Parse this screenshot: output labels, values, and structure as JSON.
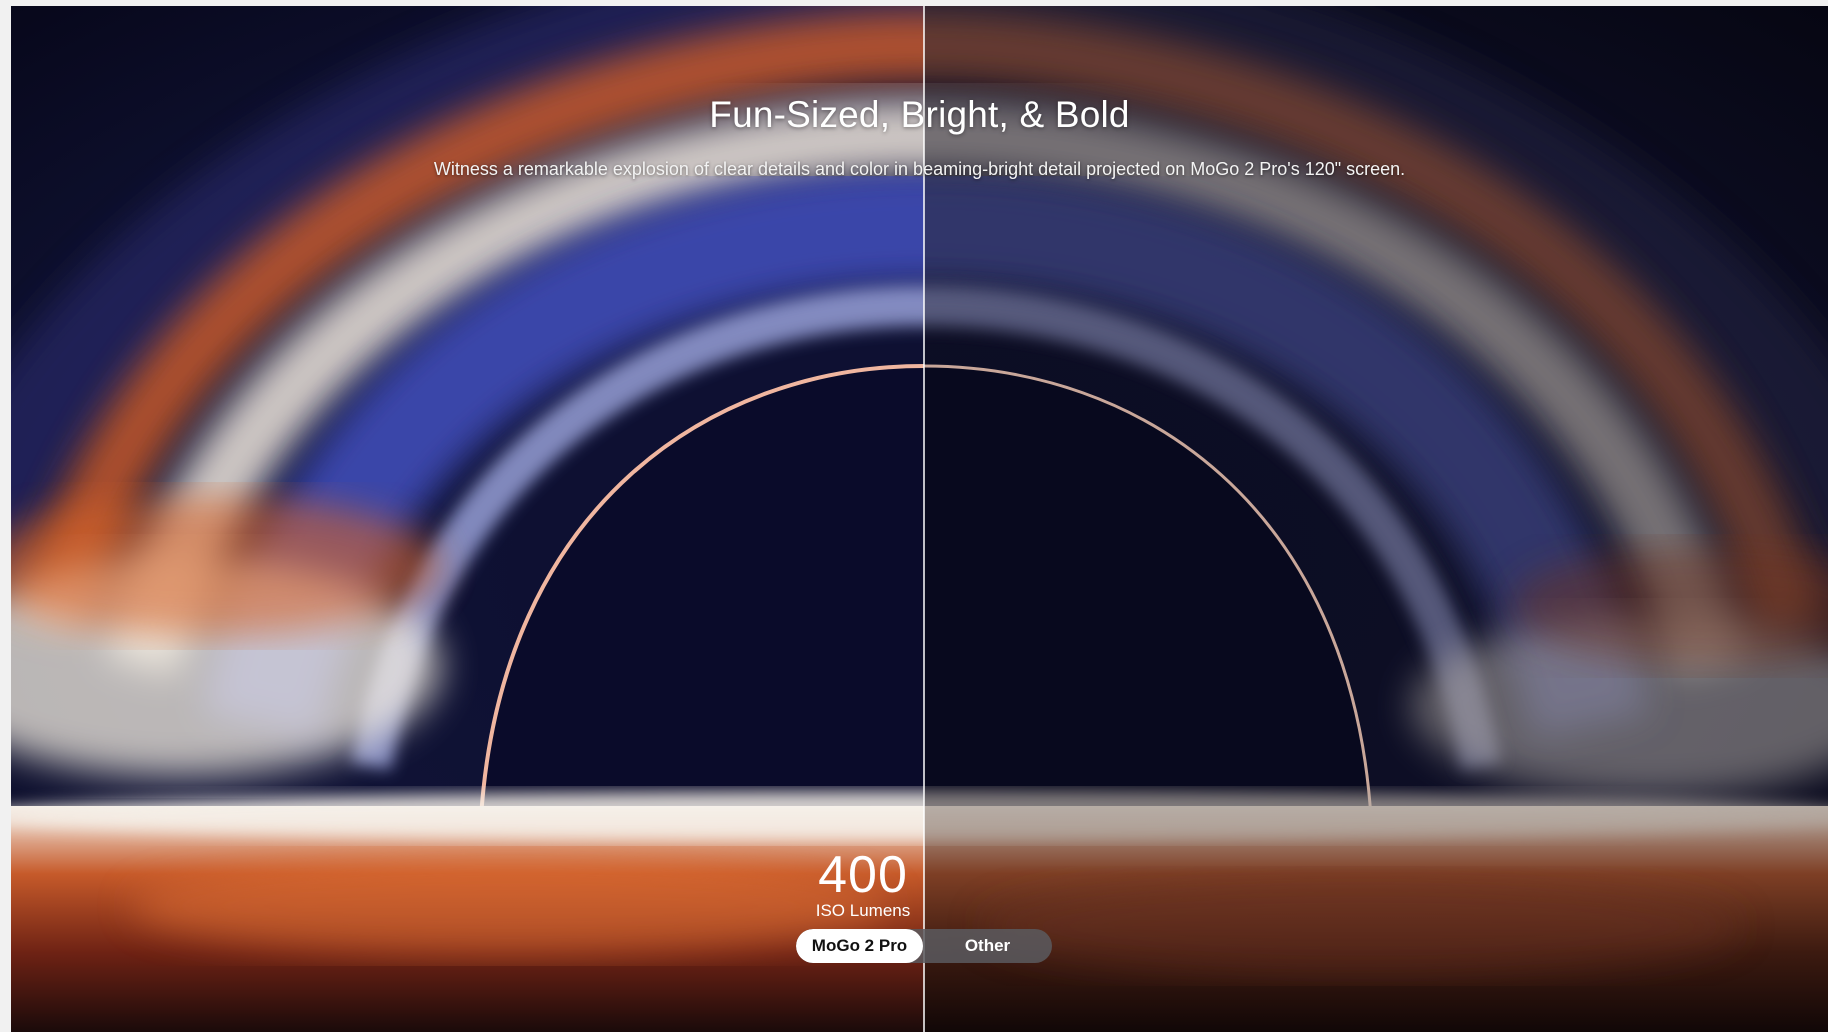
{
  "headline": "Fun-Sized, Bright, & Bold",
  "subline": "Witness a remarkable explosion of clear details and color in beaming-bright detail projected on MoGo 2 Pro's 120\" screen.",
  "stat": {
    "value": "400",
    "unit": "ISO Lumens"
  },
  "toggle": {
    "options": [
      "MoGo 2 Pro",
      "Other"
    ],
    "selected": "MoGo 2 Pro"
  },
  "colors": {
    "space": "#0a0b22",
    "ring_blue": "#3b46a8",
    "ring_orange": "#d9622e",
    "ring_white": "#f2ece6",
    "toggle_track": "#5a5a5f"
  }
}
